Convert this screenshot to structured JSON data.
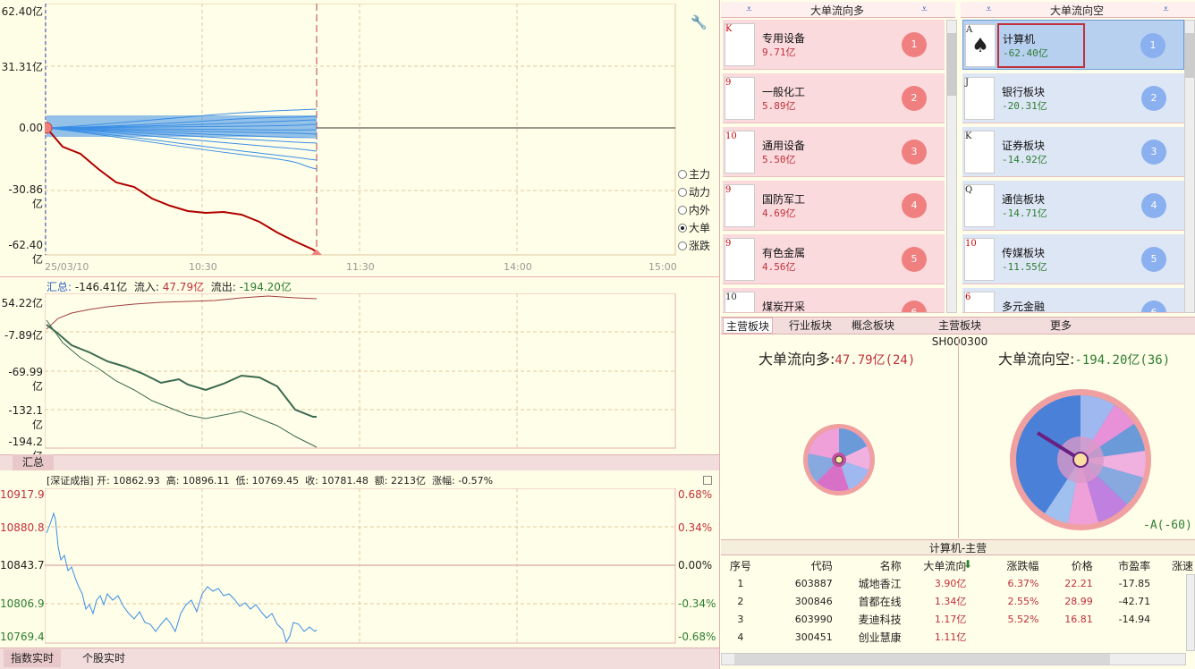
{
  "main_chart": {
    "y_labels": [
      "62.40亿",
      "31.31亿",
      "0.00",
      "-30.86亿",
      "-62.40亿"
    ],
    "x_labels": [
      "25/03/10",
      "10:30",
      "11:30",
      "14:00",
      "15:00"
    ],
    "radio_options": [
      {
        "label": "主力",
        "selected": false
      },
      {
        "label": "动力",
        "selected": false
      },
      {
        "label": "内外",
        "selected": false
      },
      {
        "label": "大单",
        "selected": true
      },
      {
        "label": "涨跌",
        "selected": false
      }
    ]
  },
  "flow_chart": {
    "summary_label": "汇总:",
    "summary_value": "-146.41亿",
    "inflow_label": "流入:",
    "inflow_value": "47.79亿",
    "outflow_label": "流出:",
    "outflow_value": "-194.20亿",
    "y_labels": [
      "54.22亿",
      "-7.89亿",
      "-69.99亿",
      "-132.1亿",
      "-194.2亿"
    ],
    "tab_label": "汇总"
  },
  "index_chart": {
    "header": "[深证成指] 开: 10862.93  高: 10896.11  低: 10769.45  收: 10781.48  额: 2213亿  涨幅: -0.57%",
    "y_labels_left": [
      "10917.99",
      "10880.80",
      "10843.73",
      "10806.97",
      "10769.48"
    ],
    "y_labels_right": [
      "0.68%",
      "0.34%",
      "0.00%",
      "-0.34%",
      "-0.68%"
    ],
    "tabs": [
      "指数实时",
      "个股实时"
    ]
  },
  "left_list": {
    "title": "大单流向多",
    "items": [
      {
        "card": "K",
        "name": "专用设备",
        "value": "9.71亿",
        "rank": "1"
      },
      {
        "card": "9",
        "name": "一般化工",
        "value": "5.89亿",
        "rank": "2"
      },
      {
        "card": "10",
        "name": "通用设备",
        "value": "5.50亿",
        "rank": "3"
      },
      {
        "card": "9",
        "name": "国防军工",
        "value": "4.69亿",
        "rank": "4"
      },
      {
        "card": "9",
        "name": "有色金属",
        "value": "4.56亿",
        "rank": "5"
      },
      {
        "card": "10",
        "name": "煤炭开采",
        "value": "",
        "rank": "6"
      }
    ]
  },
  "right_list": {
    "title": "大单流向空",
    "items": [
      {
        "card": "A",
        "name": "计算机",
        "value": "-62.40亿",
        "rank": "1"
      },
      {
        "card": "J",
        "name": "银行板块",
        "value": "-20.31亿",
        "rank": "2"
      },
      {
        "card": "K",
        "name": "证券板块",
        "value": "-14.92亿",
        "rank": "3"
      },
      {
        "card": "Q",
        "name": "通信板块",
        "value": "-14.71亿",
        "rank": "4"
      },
      {
        "card": "10",
        "name": "传媒板块",
        "value": "-11.55亿",
        "rank": "5"
      },
      {
        "card": "6",
        "name": "多元金融",
        "value": "",
        "rank": "6"
      }
    ]
  },
  "sector_tabs": [
    "主营板块",
    "行业板块",
    "概念板块",
    "主营板块SH000300",
    "更多"
  ],
  "pie_left": {
    "title": "大单流向多:",
    "value": "47.79亿(24)"
  },
  "pie_right": {
    "title": "大单流向空:",
    "value": "-194.20亿(36)",
    "footer": "-A(-60)"
  },
  "detail_table": {
    "title": "计算机-主营",
    "headers": [
      "序号",
      "代码",
      "名称",
      "大单流向",
      "涨跌幅",
      "价格",
      "市盈率",
      "涨速"
    ],
    "rows": [
      [
        "1",
        "603887",
        "城地香江",
        "3.90亿",
        "6.37%",
        "22.21",
        "-17.85"
      ],
      [
        "2",
        "300846",
        "首都在线",
        "1.34亿",
        "2.55%",
        "28.99",
        "-42.71"
      ],
      [
        "3",
        "603990",
        "麦迪科技",
        "1.17亿",
        "5.52%",
        "16.81",
        "-14.94"
      ],
      [
        "4",
        "300451",
        "创业慧康",
        "1.11亿",
        "",
        "",
        ""
      ]
    ]
  },
  "colors": {
    "up": "#c0303a",
    "down": "#2e7d32",
    "neutral": "#222222",
    "grid": "#e0c8a0",
    "accent_red": "#b00000",
    "line_blue": "#3a8ee6"
  }
}
